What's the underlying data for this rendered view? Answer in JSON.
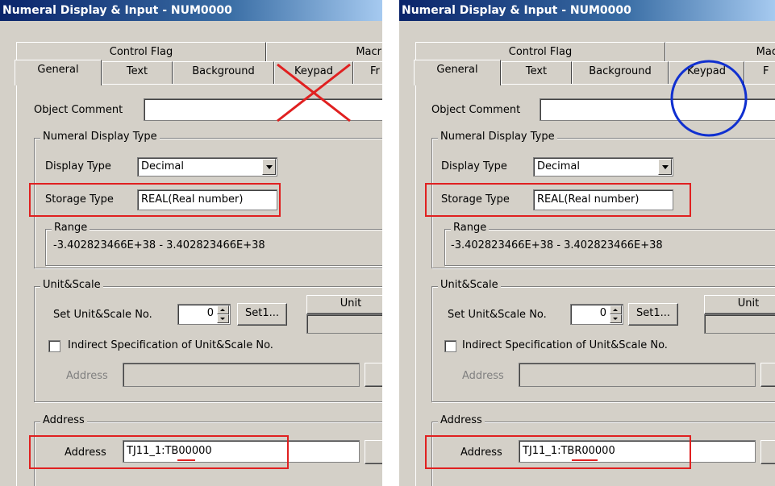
{
  "left": {
    "title": "Numeral Display & Input - NUM0000",
    "tabs_row2": [
      "Control Flag",
      "Macr"
    ],
    "tabs_row1": [
      "General",
      "Text",
      "Background",
      "Keypad",
      "Fr"
    ],
    "object_comment_label": "Object Comment",
    "numeral_group": "Numeral Display Type",
    "display_type_label": "Display Type",
    "display_type_value": "Decimal",
    "storage_type_label": "Storage Type",
    "storage_type_value": "REAL(Real number)",
    "range_group": "Range",
    "range_value": "-3.402823466E+38 - 3.402823466E+38",
    "unit_group": "Unit&Scale",
    "set_unit_label": "Set Unit&Scale No.",
    "unit_no": "0",
    "set_button": "Set1...",
    "unit_header": "Unit",
    "indirect_label": "Indirect Specification of Unit&Scale No.",
    "address_label_disabled": "Address",
    "address_group": "Address",
    "address_label": "Address",
    "address_value": "TJ11_1:TB00000"
  },
  "right": {
    "title": "Numeral Display & Input - NUM0000",
    "tabs_row2": [
      "Control Flag",
      "Mac"
    ],
    "tabs_row1": [
      "General",
      "Text",
      "Background",
      "Keypad",
      "F"
    ],
    "object_comment_label": "Object Comment",
    "numeral_group": "Numeral Display Type",
    "display_type_label": "Display Type",
    "display_type_value": "Decimal",
    "storage_type_label": "Storage Type",
    "storage_type_value": "REAL(Real number)",
    "range_group": "Range",
    "range_value": "-3.402823466E+38 - 3.402823466E+38",
    "unit_group": "Unit&Scale",
    "set_unit_label": "Set Unit&Scale No.",
    "unit_no": "0",
    "set_button": "Set1...",
    "unit_header": "Unit",
    "indirect_label": "Indirect Specification of Unit&Scale No.",
    "address_label_disabled": "Address",
    "address_group": "Address",
    "address_label": "Address",
    "address_value": "TJ11_1:TBR00000"
  },
  "annotations": {
    "left_keypad_mark": "red-cross",
    "right_keypad_mark": "blue-circle",
    "highlight_color": "#e02020",
    "circle_color": "#1030d0"
  }
}
